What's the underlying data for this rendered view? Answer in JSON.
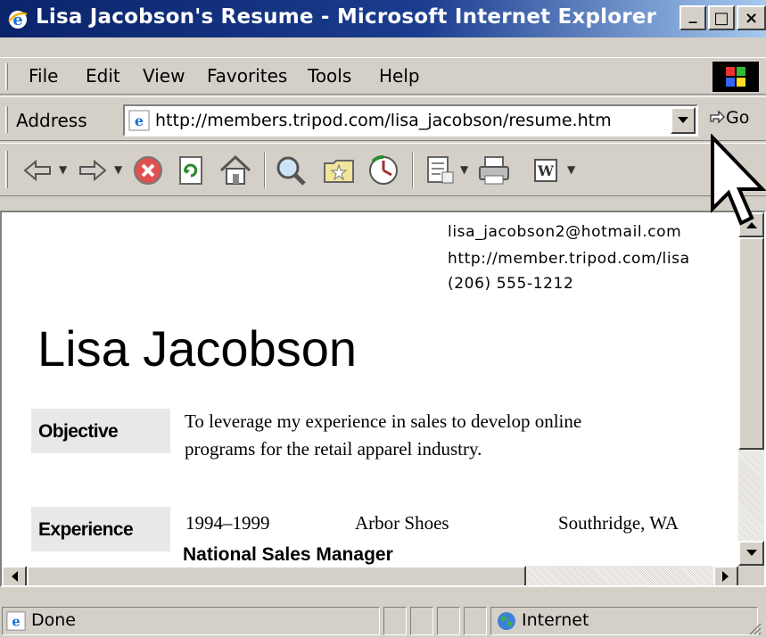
{
  "window": {
    "title": "Lisa Jacobson's Resume - Microsoft Internet Explorer",
    "controls": {
      "minimize": "_",
      "maximize": "□",
      "close": "×"
    }
  },
  "menu": {
    "items": [
      "File",
      "Edit",
      "View",
      "Favorites",
      "Tools",
      "Help"
    ]
  },
  "address": {
    "label": "Address",
    "url": "http://members.tripod.com/lisa_jacobson/resume.htm",
    "go_label": "Go"
  },
  "toolbar": {
    "buttons": [
      "back-icon",
      "forward-icon",
      "stop-icon",
      "refresh-icon",
      "home-icon",
      "search-icon",
      "favorites-icon",
      "history-icon",
      "mail-icon",
      "print-icon",
      "edit-icon"
    ]
  },
  "page": {
    "contact": {
      "email": "lisa_jacobson2@hotmail.com",
      "website": "http://member.tripod.com/lisa",
      "phone": "(206) 555-1212"
    },
    "name": "Lisa Jacobson",
    "objective": {
      "label": "Objective",
      "line1": "To leverage my experience in sales to develop online",
      "line2": "programs for the  retail apparel industry."
    },
    "experience": {
      "label": "Experience",
      "years": "1994–1999",
      "company": "Arbor Shoes",
      "location": "Southridge, WA",
      "title": "National Sales Manager"
    }
  },
  "status": {
    "text": "Done",
    "zone": "Internet"
  },
  "colors": {
    "titlebar_start": "#0a246a",
    "titlebar_end": "#a6caf0",
    "chrome": "#d4d0c8",
    "section_bg": "#e8e8e8"
  }
}
